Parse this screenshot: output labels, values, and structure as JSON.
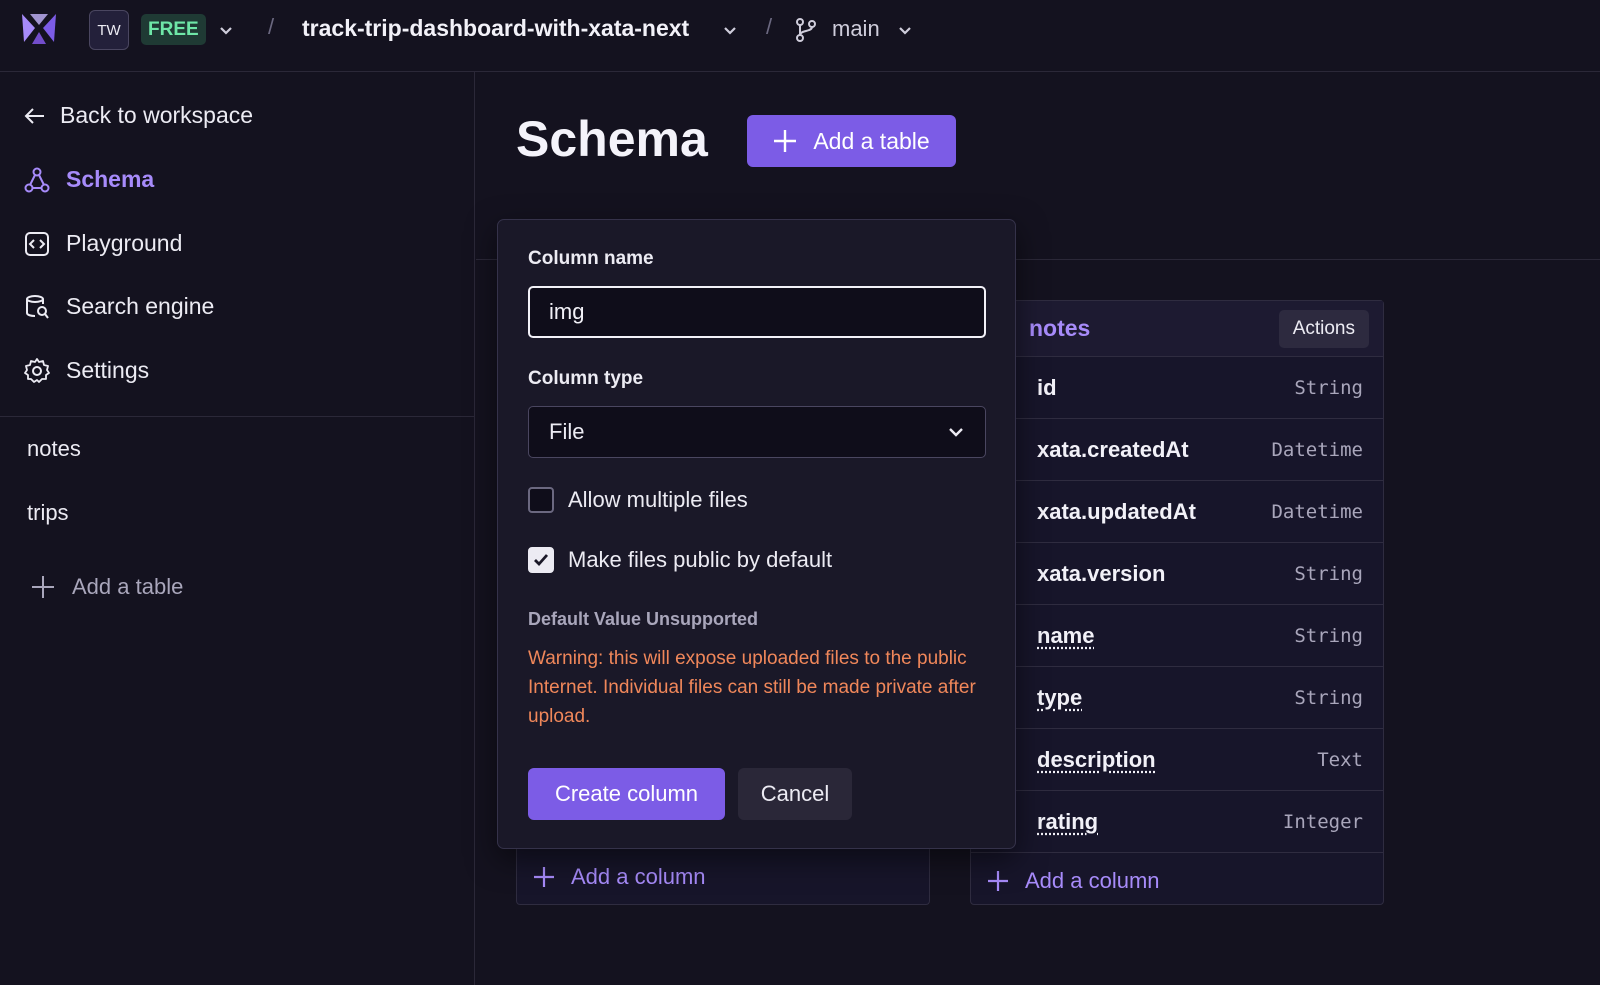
{
  "topbar": {
    "workspace_initials": "TW",
    "plan_badge": "FREE",
    "database_name": "track-trip-dashboard-with-xata-next",
    "separator": "/",
    "branch": "main"
  },
  "sidebar": {
    "back_label": "Back to workspace",
    "nav": [
      {
        "label": "Schema",
        "icon": "schema-icon",
        "active": true
      },
      {
        "label": "Playground",
        "icon": "code-icon",
        "active": false
      },
      {
        "label": "Search engine",
        "icon": "search-engine-icon",
        "active": false
      },
      {
        "label": "Settings",
        "icon": "gear-icon",
        "active": false
      }
    ],
    "tables": [
      "notes",
      "trips"
    ],
    "add_table_label": "Add a table"
  },
  "main": {
    "title": "Schema",
    "add_table_button": "Add a table"
  },
  "notes_table": {
    "title": "notes",
    "actions_label": "Actions",
    "columns": [
      {
        "name": "id",
        "type": "String"
      },
      {
        "name": "xata.createdAt",
        "type": "Datetime"
      },
      {
        "name": "xata.updatedAt",
        "type": "Datetime"
      },
      {
        "name": "xata.version",
        "type": "String"
      },
      {
        "name": "name",
        "type": "String"
      },
      {
        "name": "type",
        "type": "String"
      },
      {
        "name": "description",
        "type": "Text"
      },
      {
        "name": "rating",
        "type": "Integer"
      }
    ],
    "add_column_label": "Add a column"
  },
  "trips_table": {
    "add_column_label": "Add a column"
  },
  "column_form": {
    "name_label": "Column name",
    "name_value": "img",
    "type_label": "Column type",
    "type_value": "File",
    "allow_multiple_label": "Allow multiple files",
    "allow_multiple_checked": false,
    "public_label": "Make files public by default",
    "public_checked": true,
    "default_value_label": "Default Value Unsupported",
    "warning": "Warning: this will expose uploaded files to the public Internet. Individual files can still be made private after upload.",
    "create_label": "Create column",
    "cancel_label": "Cancel"
  },
  "colors": {
    "accent": "#7c5ce6",
    "accent_text": "#a78bfa",
    "warning": "#f0875a",
    "free_badge": "#6ee7a7",
    "background": "#14121f"
  }
}
